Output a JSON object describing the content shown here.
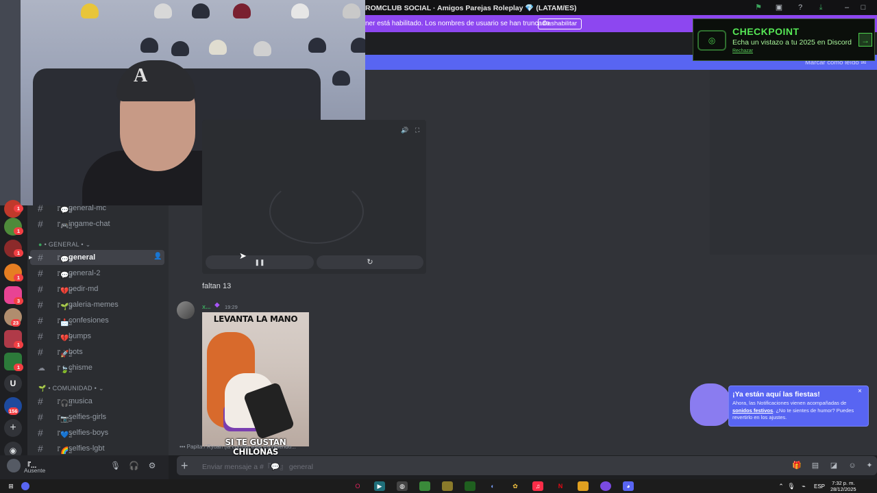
{
  "window": {
    "title": "ROMCLUB SOCIAL · Amigos Parejas Roleplay",
    "title_suffix": "(LATAM/ES)",
    "heart": "💎"
  },
  "notice": {
    "text": "ner está habilitado. Los nombres de usuario se han truncado.",
    "button": "Deshabilitar"
  },
  "mark_read": "Marcar como leído",
  "checkpoint": {
    "title": "CHECKPOINT",
    "subtitle": "Echa un vistazo a tu 2025 en Discord",
    "reject": "Rechazar",
    "arrow": "→"
  },
  "servers": {
    "badges": [
      "1",
      "1",
      "1",
      "1",
      "3",
      "23",
      "1",
      "1",
      "156"
    ],
    "letter": "U"
  },
  "channels": {
    "top": [
      {
        "emoji": "『💬』",
        "name": "general-mc"
      },
      {
        "emoji": "『🎮』",
        "name": "ingame-chat"
      }
    ],
    "cat_general": "• GENERAL •",
    "general": [
      {
        "emoji": "『💬』",
        "name": "general"
      },
      {
        "emoji": "『💬』",
        "name": "general-2"
      },
      {
        "emoji": "『💔』",
        "name": "pedir-md"
      },
      {
        "emoji": "『🌱』",
        "name": "galeria-memes"
      },
      {
        "emoji": "『📩』",
        "name": "confesiones"
      },
      {
        "emoji": "『💔』",
        "name": "bumps"
      },
      {
        "emoji": "『🚀』",
        "name": "bots"
      },
      {
        "emoji": "『🍃』",
        "name": "chisme"
      }
    ],
    "cat_comunidad": "• COMUNIDAD •",
    "comunidad": [
      {
        "emoji": "『🎧』",
        "name": "musica"
      },
      {
        "emoji": "『📷』",
        "name": "selfies-girls"
      },
      {
        "emoji": "『💙』",
        "name": "selfies-boys"
      },
      {
        "emoji": "『🌈』",
        "name": "selfies-lgbt"
      }
    ]
  },
  "user": {
    "name": "『...",
    "status": "Ausente"
  },
  "chat": {
    "message1": "faltan 13",
    "author": "x...",
    "time": "19:29",
    "gif_top": "LEVANTA LA MANO",
    "gif_bottom": "SI TE GUSTAN CHILONAS",
    "typing": "Papita / Ryuan (la cucrita) está escribiendo...",
    "composer_placeholder": "Enviar mensaje a #『💬』 general"
  },
  "toast": {
    "title": "¡Ya están aquí las fiestas!",
    "body_pre": "Ahora, las Notificaciones vienen acompañadas de ",
    "body_link": "sonidos festivos",
    "body_post": ". ¿No te sientes de humor? Puedes revertirlo en los ajustes.",
    "close": "×"
  },
  "taskbar": {
    "lang": "ESP",
    "time": "7:32 p. m.",
    "date": "28/12/2025"
  },
  "colors": {
    "accent": "#5865f2",
    "notice": "#8d47f0",
    "checkpoint_green": "#56e856"
  }
}
